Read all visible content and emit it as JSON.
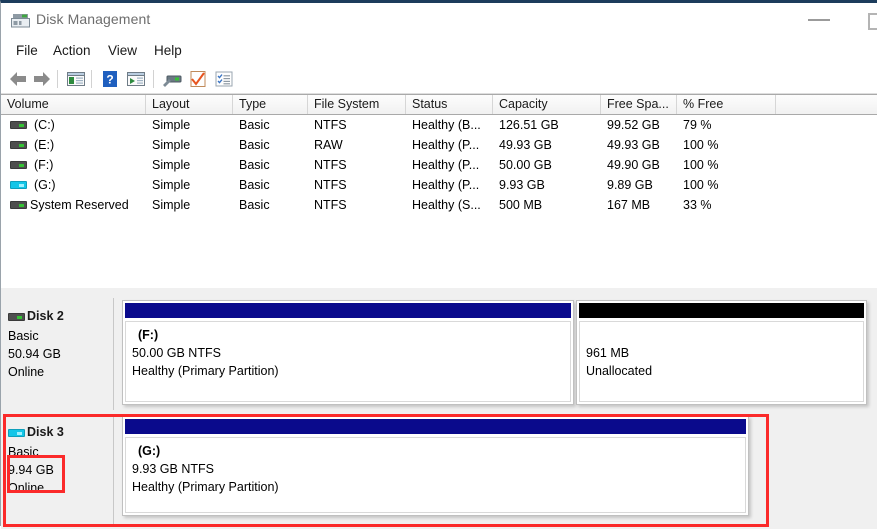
{
  "window": {
    "title": "Disk Management",
    "icon": "disk-management-icon",
    "controls": {
      "minimize": "─",
      "maximize": "□"
    }
  },
  "menu": {
    "items": [
      {
        "label": "File"
      },
      {
        "label": "Action"
      },
      {
        "label": "View"
      },
      {
        "label": "Help"
      }
    ]
  },
  "toolbar": {
    "buttons": [
      {
        "name": "back-arrow-icon",
        "title": "Back"
      },
      {
        "name": "forward-arrow-icon",
        "title": "Forward"
      },
      {
        "name": "show-hide-console-tree-icon",
        "title": "Show/Hide Console Tree"
      },
      {
        "name": "help-icon",
        "title": "Help"
      },
      {
        "name": "show-hide-action-pane-icon",
        "title": "Show/Hide Action Pane"
      },
      {
        "name": "properties-disk-icon",
        "title": "Properties"
      },
      {
        "name": "rescan-disks-icon",
        "title": "Rescan Disks"
      },
      {
        "name": "list-view-icon",
        "title": "List View"
      }
    ]
  },
  "volume_list": {
    "columns": [
      {
        "label": "Volume"
      },
      {
        "label": "Layout"
      },
      {
        "label": "Type"
      },
      {
        "label": "File System"
      },
      {
        "label": "Status"
      },
      {
        "label": "Capacity"
      },
      {
        "label": "Free Spa..."
      },
      {
        "label": "% Free"
      },
      {
        "label": ""
      }
    ],
    "rows": [
      {
        "volume": "(C:)",
        "layout": "Simple",
        "type": "Basic",
        "file_system": "NTFS",
        "status": "Healthy (B...",
        "capacity": "126.51 GB",
        "free_space": "99.52 GB",
        "percent_free": "79 %",
        "icon": "drive-icon",
        "selected": false
      },
      {
        "volume": "(E:)",
        "layout": "Simple",
        "type": "Basic",
        "file_system": "RAW",
        "status": "Healthy (P...",
        "capacity": "49.93 GB",
        "free_space": "49.93 GB",
        "percent_free": "100 %",
        "icon": "drive-icon",
        "selected": false
      },
      {
        "volume": "(F:)",
        "layout": "Simple",
        "type": "Basic",
        "file_system": "NTFS",
        "status": "Healthy (P...",
        "capacity": "50.00 GB",
        "free_space": "49.90 GB",
        "percent_free": "100 %",
        "icon": "drive-icon",
        "selected": false
      },
      {
        "volume": "(G:)",
        "layout": "Simple",
        "type": "Basic",
        "file_system": "NTFS",
        "status": "Healthy (P...",
        "capacity": "9.93 GB",
        "free_space": "9.89 GB",
        "percent_free": "100 %",
        "icon": "drive-icon-highlighted",
        "selected": true
      },
      {
        "volume": "System Reserved",
        "layout": "Simple",
        "type": "Basic",
        "file_system": "NTFS",
        "status": "Healthy (S...",
        "capacity": "500 MB",
        "free_space": "167 MB",
        "percent_free": "33 %",
        "icon": "drive-icon",
        "selected": false
      }
    ]
  },
  "graphical_view": {
    "disks": [
      {
        "name": "Disk 2",
        "type": "Basic",
        "size": "50.94 GB",
        "state": "Online",
        "icon": "disk-icon",
        "partitions": [
          {
            "label": "(F:)",
            "size_fs": "50.00 GB NTFS",
            "status": "Healthy (Primary Partition)",
            "bar_color": "#0a0a8c",
            "kind": "primary"
          },
          {
            "label": "",
            "size_fs": "961 MB",
            "status": "Unallocated",
            "bar_color": "#000000",
            "kind": "unallocated"
          }
        ]
      },
      {
        "name": "Disk 3",
        "type": "Basic",
        "size": "9.94 GB",
        "state": "Online",
        "icon": "disk-icon-highlighted",
        "partitions": [
          {
            "label": "(G:)",
            "size_fs": "9.93 GB NTFS",
            "status": "Healthy (Primary Partition)",
            "bar_color": "#0a0a8c",
            "kind": "primary"
          }
        ]
      }
    ]
  },
  "annotations": {
    "color": "#fb2a2a",
    "boxes": [
      {
        "name": "disk3-size-state-highlight",
        "target": "Disk 3 size and Online state"
      },
      {
        "name": "disk3-row-highlight",
        "target": "Disk 3 entire row"
      }
    ]
  }
}
